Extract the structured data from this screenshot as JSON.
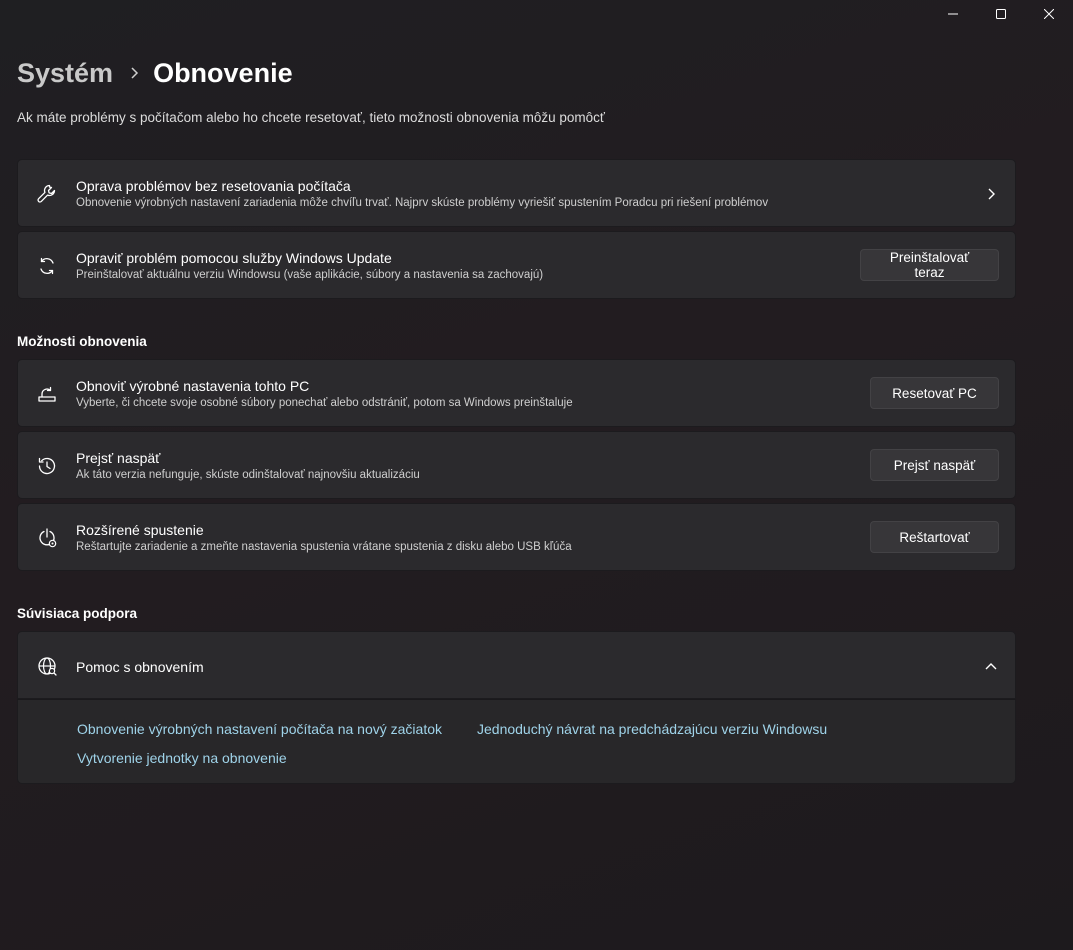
{
  "breadcrumb": {
    "parent": "Systém",
    "current": "Obnovenie"
  },
  "subtitle": "Ak máte problémy s počítačom alebo ho chcete resetovať, tieto možnosti obnovenia môžu pomôcť",
  "cards": {
    "fix": {
      "title": "Oprava problémov bez resetovania počítača",
      "desc": "Obnovenie výrobných nastavení zariadenia môže chvíľu trvať. Najprv skúste problémy vyriešiť spustením Poradcu pri riešení problémov",
      "icon": "wrench-icon"
    },
    "wu": {
      "title": "Opraviť problém pomocou služby Windows Update",
      "desc": "Preinštalovať aktuálnu verziu Windowsu (vaše aplikácie, súbory a nastavenia sa zachovajú)",
      "button": "Preinštalovať teraz",
      "icon": "sync-icon"
    }
  },
  "recovery_section": {
    "title": "Možnosti obnovenia",
    "reset": {
      "title": "Obnoviť výrobné nastavenia tohto PC",
      "desc": "Vyberte, či chcete svoje osobné súbory ponechať alebo odstrániť, potom sa Windows preinštaluje",
      "button": "Resetovať PC",
      "icon": "reset-pc-icon"
    },
    "goback": {
      "title": "Prejsť naspäť",
      "desc": "Ak táto verzia nefunguje, skúste odinštalovať najnovšiu aktualizáciu",
      "button": "Prejsť naspäť",
      "icon": "history-icon"
    },
    "advanced": {
      "title": "Rozšírené spustenie",
      "desc": "Reštartujte zariadenie a zmeňte nastavenia spustenia vrátane spustenia z disku alebo USB kľúča",
      "button": "Reštartovať",
      "icon": "advanced-startup-icon"
    }
  },
  "support_section": {
    "title": "Súvisiaca podpora",
    "help": {
      "title": "Pomoc s obnovením",
      "icon": "globe-icon",
      "links": [
        "Obnovenie výrobných nastavení počítača na nový začiatok",
        "Jednoduchý návrat na predchádzajúcu verziu Windowsu",
        "Vytvorenie jednotky na obnovenie"
      ]
    }
  },
  "colors": {
    "link": "#9fd3e9",
    "card_bg": "#2b2a2d",
    "button_bg": "#373639"
  }
}
